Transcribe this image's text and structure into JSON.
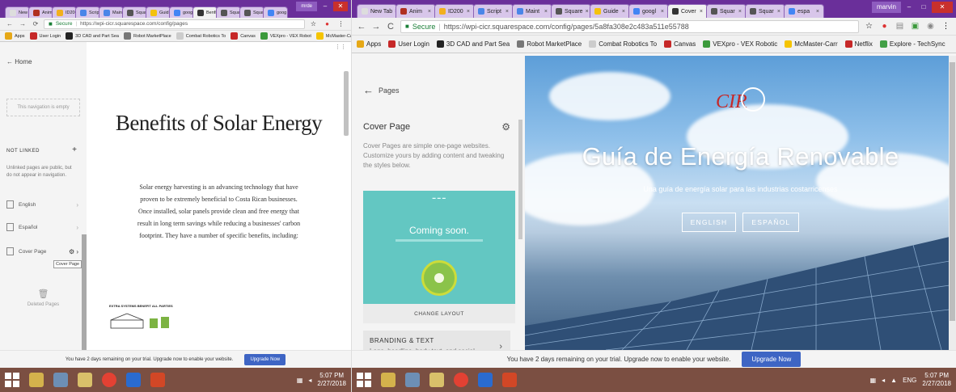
{
  "left": {
    "tabs": [
      {
        "label": "New Tab",
        "color": "#dddddd"
      },
      {
        "label": "Anima",
        "color": "#b03020"
      },
      {
        "label": "ID200",
        "color": "#f2b01e"
      },
      {
        "label": "Script",
        "color": "#4a86e8"
      },
      {
        "label": "Maint",
        "color": "#4a86e8"
      },
      {
        "label": "Squar",
        "color": "#555555"
      },
      {
        "label": "Guid",
        "color": "#f4c20d"
      },
      {
        "label": "googl",
        "color": "#4285f4"
      },
      {
        "label": "Benfi",
        "color": "#333333"
      },
      {
        "label": "Squar",
        "color": "#555555"
      },
      {
        "label": "Squar",
        "color": "#555555"
      },
      {
        "label": "goog",
        "color": "#4285f4"
      }
    ],
    "active_tab": 8,
    "window_user": "mrde",
    "address": {
      "secure": "Secure",
      "url": "https://wpi-cicr.squarespace.com/config/pages"
    },
    "bookmarks": [
      {
        "label": "Apps",
        "color": "#e6a817"
      },
      {
        "label": "User Login",
        "color": "#c62828"
      },
      {
        "label": "3D CAD and Part Sea",
        "color": "#222222"
      },
      {
        "label": "Robot MarketPlace",
        "color": "#777777"
      },
      {
        "label": "Combat Robotics To",
        "color": "#cccccc"
      },
      {
        "label": "Canvas",
        "color": "#c62828"
      },
      {
        "label": "VEXpro - VEX Robot",
        "color": "#3c9a3c"
      },
      {
        "label": "McMaster-Carr",
        "color": "#f5c400"
      },
      {
        "label": "Netflix",
        "color": "#c62828"
      },
      {
        "label": "Explore - TechSync",
        "color": "#43a047"
      }
    ],
    "sidebar": {
      "back": "Home",
      "empty": "This navigation is empty",
      "not_linked": "NOT LINKED",
      "not_linked_desc": "Unlinked pages are public, but do not appear in navigation.",
      "pages": [
        {
          "label": "English"
        },
        {
          "label": "Español"
        },
        {
          "label": "Cover Page"
        }
      ],
      "tooltip": "Cover Page",
      "deleted": "Deleted Pages"
    },
    "preview": {
      "title": "Benefits of Solar Energy",
      "body": "Solar energy harvesting is an advancing technology that have proven to be extremely beneficial to Costa Rican businesses. Once installed, solar panels provide clean and free energy that result in long term savings while reducing a businesses' carbon footprint. They have a number of specific benefits, including:",
      "graphic_label": "EXTRA SYSTEMS BENEFIT ALL PARTIES"
    },
    "trial": {
      "text": "You have 2 days remaining on your trial. Upgrade now to enable your website.",
      "button": "Upgrade Now"
    },
    "clock": {
      "time": "5:07 PM",
      "date": "2/27/2018"
    }
  },
  "right": {
    "tabs": [
      {
        "label": "New Tab",
        "color": "#dddddd"
      },
      {
        "label": "Anim",
        "color": "#b03020"
      },
      {
        "label": "ID200",
        "color": "#f2b01e"
      },
      {
        "label": "Script",
        "color": "#4a86e8"
      },
      {
        "label": "Maint",
        "color": "#4a86e8"
      },
      {
        "label": "Square",
        "color": "#555555"
      },
      {
        "label": "Guide",
        "color": "#f4c20d"
      },
      {
        "label": "googl",
        "color": "#4285f4"
      },
      {
        "label": "Cover",
        "color": "#333333"
      },
      {
        "label": "Squar",
        "color": "#555555"
      },
      {
        "label": "Squar",
        "color": "#555555"
      },
      {
        "label": "espa",
        "color": "#4285f4"
      }
    ],
    "active_tab": 8,
    "window_user": "marvin",
    "address": {
      "secure": "Secure",
      "url": "https://wpi-cicr.squarespace.com/config/pages/5a8fa308e2c483a511e55788"
    },
    "bookmarks": [
      {
        "label": "Apps",
        "color": "#e6a817"
      },
      {
        "label": "User Login",
        "color": "#c62828"
      },
      {
        "label": "3D CAD and Part Sea",
        "color": "#222222"
      },
      {
        "label": "Robot MarketPlace",
        "color": "#777777"
      },
      {
        "label": "Combat Robotics To",
        "color": "#cccccc"
      },
      {
        "label": "Canvas",
        "color": "#c62828"
      },
      {
        "label": "VEXpro - VEX Robotic",
        "color": "#3c9a3c"
      },
      {
        "label": "McMaster-Carr",
        "color": "#f5c400"
      },
      {
        "label": "Netflix",
        "color": "#c62828"
      },
      {
        "label": "Explore - TechSync",
        "color": "#43a047"
      }
    ],
    "sidebar": {
      "back": "Pages",
      "title": "Cover Page",
      "desc": "Cover Pages are simple one-page websites. Customize yours by adding content and tweaking the styles below.",
      "thumb_title": "Coming soon.",
      "change_layout": "CHANGE LAYOUT",
      "branding_title": "BRANDING & TEXT",
      "branding_desc": "Logo, headline, body text, and social"
    },
    "preview": {
      "logo": "CIR",
      "title": "Guía de Energía Renovable",
      "subtitle": "Una guía de energía solar para las industrias costarricenses",
      "btn_en": "ENGLISH",
      "btn_es": "ESPAÑOL"
    },
    "trial": {
      "text": "You have 2 days remaining on your trial. Upgrade now to enable your website.",
      "button": "Upgrade Now"
    },
    "tray_lang": "ENG",
    "clock": {
      "time": "5:07 PM",
      "date": "2/27/2018"
    }
  }
}
